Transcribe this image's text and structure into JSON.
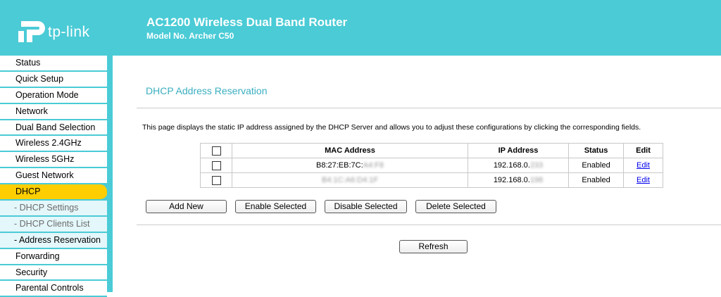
{
  "header": {
    "logo_text": "tp-link",
    "title": "AC1200 Wireless Dual Band Router",
    "model": "Model No. Archer C50"
  },
  "colors": {
    "brand": "#4acbd6",
    "active_menu": "#ffce00",
    "link": "#0000ee"
  },
  "menu": [
    {
      "label": "Status"
    },
    {
      "label": "Quick Setup"
    },
    {
      "label": "Operation Mode"
    },
    {
      "label": "Network"
    },
    {
      "label": "Dual Band Selection"
    },
    {
      "label": "Wireless 2.4GHz"
    },
    {
      "label": "Wireless 5GHz"
    },
    {
      "label": "Guest Network"
    },
    {
      "label": "DHCP"
    },
    {
      "label": "- DHCP Settings"
    },
    {
      "label": "- DHCP Clients List"
    },
    {
      "label": "- Address Reservation"
    },
    {
      "label": "Forwarding"
    },
    {
      "label": "Security"
    },
    {
      "label": "Parental Controls"
    }
  ],
  "page": {
    "title": "DHCP Address Reservation",
    "description": "This page displays the static IP address assigned by the DHCP Server and allows you to adjust these configurations by clicking the corresponding fields."
  },
  "table": {
    "headers": [
      "MAC Address",
      "IP Address",
      "Status",
      "Edit"
    ],
    "rows": [
      {
        "mac_prefix": "B8:27:EB:7C:",
        "mac_hidden": "A4:F8",
        "ip_prefix": "192.168.0.",
        "ip_hidden": "233",
        "status": "Enabled",
        "edit": "Edit"
      },
      {
        "mac_prefix": "",
        "mac_hidden": "B4:1C:A6:D4:1F",
        "ip_prefix": "192.168.0.",
        "ip_hidden": "198",
        "status": "Enabled",
        "edit": "Edit"
      }
    ]
  },
  "buttons": {
    "add_new": "Add New",
    "enable_selected": "Enable Selected",
    "disable_selected": "Disable Selected",
    "delete_selected": "Delete Selected",
    "refresh": "Refresh"
  }
}
